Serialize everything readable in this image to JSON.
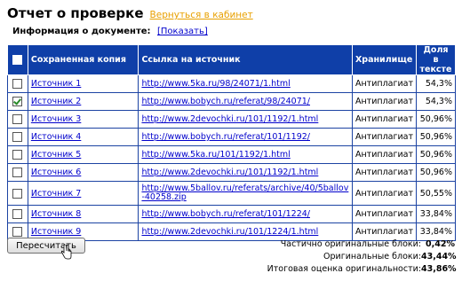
{
  "header": {
    "title": "Отчет о проверке",
    "back_link": "Вернуться в кабинет"
  },
  "doc_info": {
    "label": "Информация о документе:",
    "show_link": "[Показать]"
  },
  "table": {
    "columns": {
      "saved_copy": "Сохраненная копия",
      "source_link": "Ссылка на источник",
      "storage": "Хранилище",
      "share_line1": "Доля в",
      "share_line2": "тексте"
    },
    "rows": [
      {
        "source": "Источник 1",
        "url": "http://www.5ka.ru/98/24071/1.html",
        "storage": "Антиплагиат",
        "share": "54,3%",
        "checked": false
      },
      {
        "source": "Источник 2",
        "url": "http://www.bobych.ru/referat/98/24071/",
        "storage": "Антиплагиат",
        "share": "54,3%",
        "checked": true
      },
      {
        "source": "Источник 3",
        "url": "http://www.2devochki.ru/101/1192/1.html",
        "storage": "Антиплагиат",
        "share": "50,96%",
        "checked": false
      },
      {
        "source": "Источник 4",
        "url": "http://www.bobych.ru/referat/101/1192/",
        "storage": "Антиплагиат",
        "share": "50,96%",
        "checked": false
      },
      {
        "source": "Источник 5",
        "url": "http://www.5ka.ru/101/1192/1.html",
        "storage": "Антиплагиат",
        "share": "50,96%",
        "checked": false
      },
      {
        "source": "Источник 6",
        "url": "http://www.2devochki.ru/101/1192/1.html",
        "storage": "Антиплагиат",
        "share": "50,96%",
        "checked": false
      },
      {
        "source": "Источник 7",
        "url": "http://www.5ballov.ru/referats/archive/40/5ballov-40258.zip",
        "storage": "Антиплагиат",
        "share": "50,55%",
        "checked": false
      },
      {
        "source": "Источник 8",
        "url": "http://www.bobych.ru/referat/101/1224/",
        "storage": "Антиплагиат",
        "share": "33,84%",
        "checked": false
      },
      {
        "source": "Источник 9",
        "url": "http://www.2devochki.ru/101/1224/1.html",
        "storage": "Антиплагиат",
        "share": "33,84%",
        "checked": false
      }
    ]
  },
  "recalc_button": "Пересчитать",
  "summary": {
    "partial_label": "Частично оригинальные блоки:",
    "partial_value": "0,42%",
    "original_label": "Оригинальные блоки:",
    "original_value": "43,44%",
    "total_label": "Итоговая оценка оригинальности:",
    "total_value": "43,86%"
  }
}
